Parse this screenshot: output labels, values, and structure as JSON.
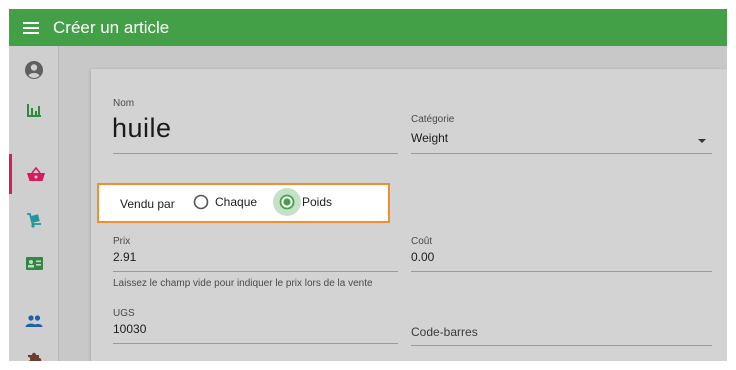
{
  "appbar": {
    "title": "Créer un article",
    "menu_icon": "hamburger-menu-icon"
  },
  "sidebar": {
    "items": [
      {
        "name": "account",
        "icon": "account-circle-icon",
        "active": false
      },
      {
        "name": "reports",
        "icon": "bar-chart-icon",
        "active": false
      },
      {
        "name": "items",
        "icon": "shopping-basket-icon",
        "active": true
      },
      {
        "name": "purchase",
        "icon": "dolly-icon",
        "active": false
      },
      {
        "name": "customers",
        "icon": "contact-card-icon",
        "active": false
      },
      {
        "name": "employees",
        "icon": "people-icon",
        "active": false
      },
      {
        "name": "apps",
        "icon": "puzzle-icon",
        "active": false
      }
    ]
  },
  "form": {
    "name": {
      "label": "Nom",
      "value": "huile"
    },
    "category": {
      "label": "Catégorie",
      "value": "Weight"
    },
    "sold_by": {
      "label": "Vendu par",
      "options": [
        {
          "label": "Chaque",
          "selected": false
        },
        {
          "label": "Poids",
          "selected": true
        }
      ]
    },
    "price": {
      "label": "Prix",
      "value": "2.91",
      "helper": "Laissez le champ vide pour indiquer le prix lors de la vente"
    },
    "cost": {
      "label": "Coût",
      "value": "0.00"
    },
    "sku": {
      "label": "UGS",
      "value": "10030"
    },
    "barcode": {
      "placeholder": "Code-barres",
      "value": ""
    }
  },
  "colors": {
    "appbar": "#43a047",
    "active_indicator": "#d81b60",
    "radio_selected": "#43a047",
    "highlight_border": "#ef8f2f"
  }
}
